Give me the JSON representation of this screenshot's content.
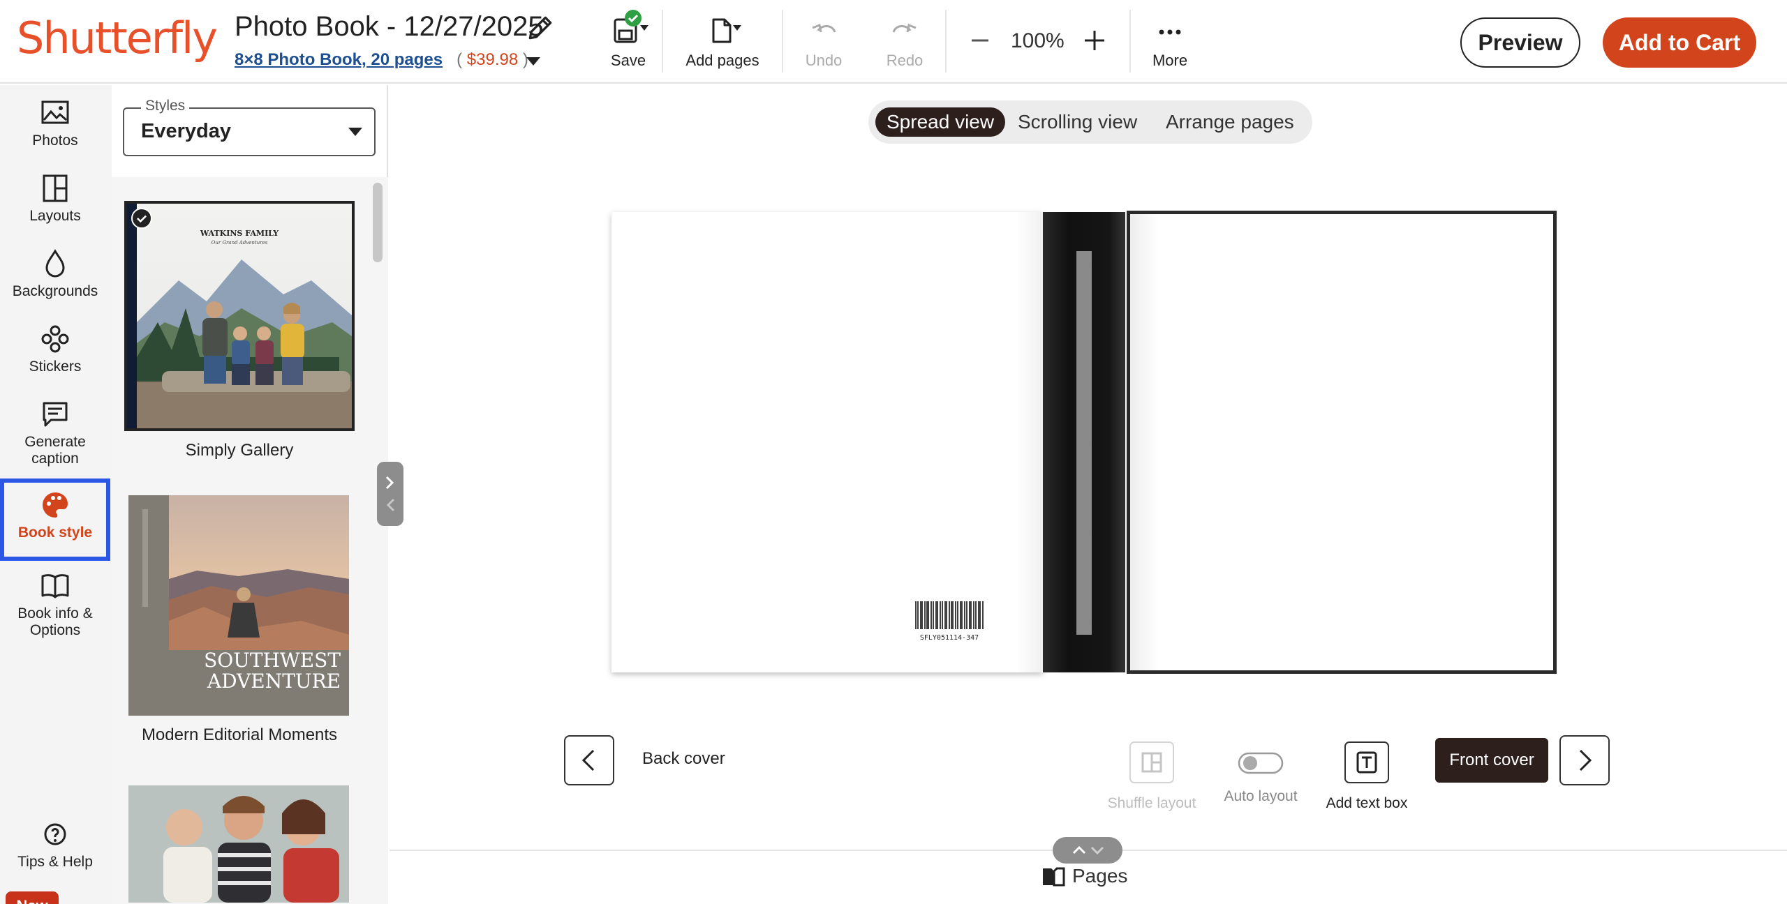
{
  "brand": {
    "logo": "Shutterfly",
    "accent": "#d2451c",
    "selection": "#2b56e6"
  },
  "project": {
    "title": "Photo Book - 12/27/2025",
    "product": "8×8 Photo Book, 20 pages",
    "paren_open": "(",
    "price": "$39.98",
    "paren_close": ")"
  },
  "toolbar": {
    "save": "Save",
    "add_pages": "Add pages",
    "undo": "Undo",
    "redo": "Redo",
    "zoom": "100%",
    "more": "More",
    "preview": "Preview",
    "add_to_cart": "Add to Cart"
  },
  "rail": {
    "items": [
      {
        "label": "Photos",
        "icon": "image-icon"
      },
      {
        "label": "Layouts",
        "icon": "layout-icon"
      },
      {
        "label": "Backgrounds",
        "icon": "drop-icon"
      },
      {
        "label": "Stickers",
        "icon": "sticker-icon"
      },
      {
        "label": "Generate caption",
        "icon": "caption-icon"
      },
      {
        "label": "Book style",
        "icon": "palette-icon",
        "active": true
      },
      {
        "label": "Book info & Options",
        "icon": "book-icon"
      }
    ],
    "badge": "New",
    "help": "Tips & Help"
  },
  "panel": {
    "styles_legend": "Styles",
    "styles_value": "Everyday",
    "cards": [
      {
        "name": "Simply Gallery",
        "selected": true,
        "thumb_title": "WATKINS FAMILY",
        "thumb_sub": "Our Grand Adventures"
      },
      {
        "name": "Modern Editorial Moments",
        "thumb_title": "SOUTHWEST ADVENTURE"
      },
      {
        "name": ""
      }
    ]
  },
  "canvas": {
    "views": [
      "Spread view",
      "Scrolling view",
      "Arrange pages"
    ],
    "active_view": "Spread view",
    "barcode": "SFLY051114-347",
    "back_label": "Back cover",
    "front_label": "Front cover",
    "tools": {
      "shuffle": "Shuffle layout",
      "auto": "Auto layout",
      "textbox": "Add text box"
    },
    "pages_tab": "Pages"
  }
}
